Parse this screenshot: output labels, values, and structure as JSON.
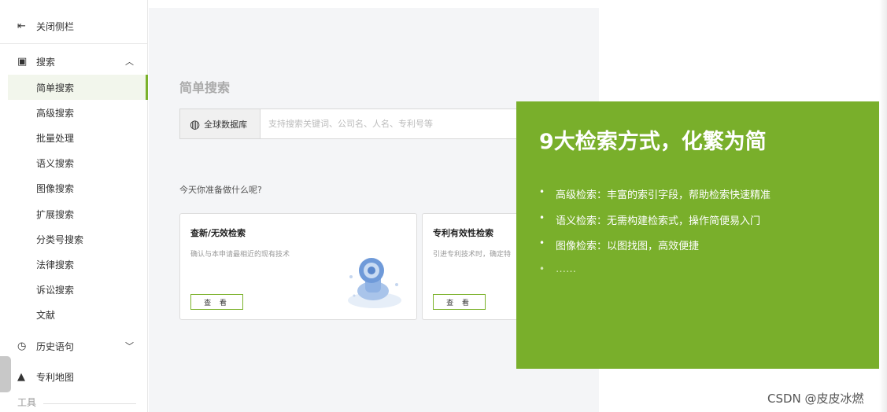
{
  "sidebar": {
    "close": {
      "icon": "collapse-sidebar-icon",
      "label": "关闭侧栏"
    },
    "search_group": {
      "icon": "search-doc-icon",
      "label": "搜索",
      "chevron": "chevron-up-icon"
    },
    "search_items": [
      {
        "label": "简单搜索",
        "active": true
      },
      {
        "label": "高级搜索"
      },
      {
        "label": "批量处理"
      },
      {
        "label": "语义搜索"
      },
      {
        "label": "图像搜索"
      },
      {
        "label": "扩展搜索"
      },
      {
        "label": "分类号搜索"
      },
      {
        "label": "法律搜索"
      },
      {
        "label": "诉讼搜索"
      },
      {
        "label": "文献"
      }
    ],
    "history_group": {
      "icon": "clock-icon",
      "label": "历史语句",
      "chevron": "chevron-down-icon"
    },
    "map_group": {
      "icon": "mountain-icon",
      "label": "专利地图"
    },
    "tools_label": "工具"
  },
  "main": {
    "title": "简单搜索",
    "search": {
      "db_label": "全球数据库",
      "db_icon": "globe-icon",
      "placeholder": "支持搜索关键词、公司名、人名、专利号等"
    },
    "prompt": "今天你准备做什么呢?",
    "cards": [
      {
        "title": "查新/无效检索",
        "desc": "确认与本申请最相近的现有技术",
        "button": "查 看"
      },
      {
        "title": "专利有效性检索",
        "desc": "引进专利技术时，确定特",
        "button": "查 看"
      }
    ]
  },
  "overlay": {
    "title": "9大检索方式，化繁为简",
    "bullets": [
      "高级检索：丰富的索引字段，帮助检索快速精准",
      "语义检索：无需构建检索式，操作简便易入门",
      "图像检索：以图找图，高效便捷",
      "……"
    ],
    "bullet_marker": "•",
    "color": "#79af2b"
  },
  "watermark": "CSDN @皮皮冰燃"
}
